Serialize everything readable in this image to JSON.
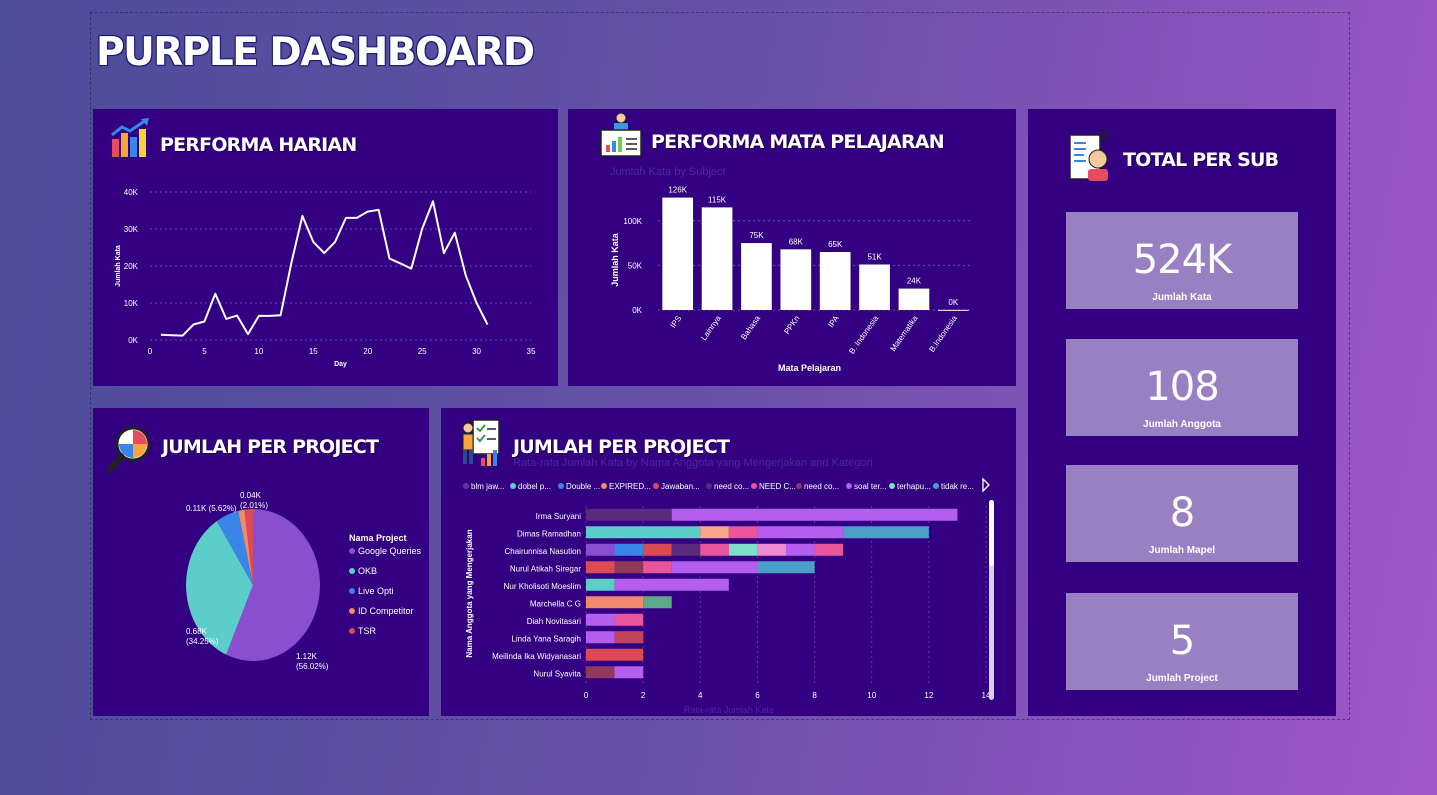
{
  "dashboard": {
    "title": "PURPLE DASHBOARD"
  },
  "colors": {
    "panel": "#330081",
    "card": "#9880c3",
    "line": "#ffffff"
  },
  "daily": {
    "title": "PERFORMA HARIAN",
    "icon": "bar-chart-trend-icon",
    "chart_data": {
      "type": "line",
      "xlabel": "Day",
      "ylabel": "Jumlah Kata",
      "xlim": [
        0,
        35
      ],
      "ylim": [
        0,
        40000
      ],
      "x_ticks": [
        "0",
        "5",
        "10",
        "15",
        "20",
        "25",
        "30",
        "35"
      ],
      "y_ticks": [
        "0K",
        "10K",
        "20K",
        "30K",
        "40K"
      ],
      "x": [
        1,
        2,
        3,
        4,
        5,
        6,
        7,
        8,
        9,
        10,
        11,
        12,
        13,
        14,
        15,
        16,
        17,
        18,
        19,
        20,
        21,
        22,
        23,
        24,
        25,
        26,
        27,
        28,
        29,
        30,
        31
      ],
      "y": [
        1400,
        1300,
        1200,
        4200,
        5000,
        12500,
        5700,
        6600,
        1600,
        6500,
        6500,
        6700,
        21000,
        33500,
        26500,
        23500,
        26500,
        33000,
        33000,
        34700,
        35200,
        22000,
        20700,
        19300,
        30000,
        37500,
        23500,
        29000,
        17500,
        10000,
        4200
      ],
      "grid": true
    }
  },
  "subject": {
    "title": "PERFORMA MATA PELAJARAN",
    "subtitle": "Jumlah Kata by Subject",
    "icon": "presentation-teacher-icon",
    "chart_data": {
      "type": "bar",
      "xlabel": "Mata Pelajaran",
      "ylabel": "Jumlah Kata",
      "categories": [
        "IPS",
        "Lainnya",
        "Bahasa",
        "PPKn",
        "IPA",
        "B. Indonesia",
        "Matematika",
        "B.Indonesia"
      ],
      "values": [
        126000,
        115000,
        75000,
        68000,
        65000,
        51000,
        24000,
        200
      ],
      "data_labels": [
        "126K",
        "115K",
        "75K",
        "68K",
        "65K",
        "51K",
        "24K",
        "0K"
      ],
      "ylim": [
        0,
        130000
      ],
      "y_ticks": [
        "0K",
        "50K",
        "100K"
      ],
      "grid": true
    }
  },
  "total": {
    "title": "TOTAL PER SUB",
    "icon": "profile-document-icon",
    "cards": [
      {
        "value": "524K",
        "label": "Jumlah Kata"
      },
      {
        "value": "108",
        "label": "Jumlah Anggota"
      },
      {
        "value": "8",
        "label": "Jumlah Mapel"
      },
      {
        "value": "5",
        "label": "Jumlah Project"
      }
    ]
  },
  "project_pie": {
    "title": "JUMLAH PER PROJECT",
    "icon": "magnifier-chart-icon",
    "legend_title": "Nama Project",
    "chart_data": {
      "type": "pie",
      "labels": [
        "Google Queries",
        "OKB",
        "Live Opti",
        "ID Competitor",
        "TSR"
      ],
      "values": [
        1120,
        680,
        110,
        30,
        40
      ],
      "colors": [
        "#8a4fd0",
        "#5ccdc8",
        "#3a86e8",
        "#f08a6c",
        "#dc4b55"
      ],
      "data_labels": [
        {
          "line1": "1.12K",
          "line2": "(56.02%)"
        },
        {
          "line1": "0.68K",
          "line2": "(34.25%)"
        },
        {
          "line1": "0.11K (5.62%)",
          "line2": ""
        },
        {
          "line1": "0.04K",
          "line2": "(2.01%)"
        }
      ]
    }
  },
  "project_bar": {
    "title": "JUMLAH PER PROJECT",
    "subtitle": "Rata-rata Jumlah Kata by Nama Anggota yang Mengerjakan and Kategori",
    "icon": "checklist-person-icon",
    "legend": [
      {
        "label": "blm jaw...",
        "color": "#6c2db0"
      },
      {
        "label": "dobel p...",
        "color": "#5ccdc8"
      },
      {
        "label": "Double ...",
        "color": "#3a86e8"
      },
      {
        "label": "EXPIRED...",
        "color": "#f08a6c"
      },
      {
        "label": "Jawaban...",
        "color": "#dc4b55"
      },
      {
        "label": "need co...",
        "color": "#5a2a7c"
      },
      {
        "label": "NEED C...",
        "color": "#e8559a"
      },
      {
        "label": "need co...",
        "color": "#8f3a5a"
      },
      {
        "label": "soal ter...",
        "color": "#b45ef0"
      },
      {
        "label": "terhapu...",
        "color": "#7ee0c8"
      },
      {
        "label": "tidak re...",
        "color": "#4aa0c8"
      }
    ],
    "chart_data": {
      "type": "bar",
      "orientation": "horizontal",
      "stacked": true,
      "ylabel": "Nama Anggota yang Mengerjakan",
      "xlabel": "Rata-rata Jumlah Kata",
      "xlim": [
        0,
        14
      ],
      "x_ticks": [
        "0",
        "2",
        "4",
        "6",
        "8",
        "10",
        "12",
        "14"
      ],
      "categories": [
        "Irma Suryani",
        "Dimas Ramadhan",
        "Chairunnisa Nasution",
        "Nurul Atikah Siregar",
        "Nur Kholisoti Moeslim",
        "Marchella C G",
        "Diah Novitasari",
        "Linda Yana Saragih",
        "Meilinda Ika Widyanasari",
        "Nurul Syavita"
      ],
      "rows": [
        [
          {
            "c": "#5a2a7c",
            "v": 3
          },
          {
            "c": "#b45ef0",
            "v": 10
          }
        ],
        [
          {
            "c": "#5ccdc8",
            "v": 4
          },
          {
            "c": "#f7a88c",
            "v": 1
          },
          {
            "c": "#e8559a",
            "v": 1
          },
          {
            "c": "#b45ef0",
            "v": 3
          },
          {
            "c": "#4aa0c8",
            "v": 3
          }
        ],
        [
          {
            "c": "#8a4fd0",
            "v": 1
          },
          {
            "c": "#3a86e8",
            "v": 1
          },
          {
            "c": "#dc4b55",
            "v": 1
          },
          {
            "c": "#5a2a7c",
            "v": 1
          },
          {
            "c": "#e8559a",
            "v": 1
          },
          {
            "c": "#7ee0c8",
            "v": 1
          },
          {
            "c": "#f08ad0",
            "v": 1
          },
          {
            "c": "#b45ef0",
            "v": 1
          },
          {
            "c": "#e8559a",
            "v": 1
          }
        ],
        [
          {
            "c": "#dc4b55",
            "v": 1
          },
          {
            "c": "#8f3a5a",
            "v": 1
          },
          {
            "c": "#e8559a",
            "v": 1
          },
          {
            "c": "#b45ef0",
            "v": 3
          },
          {
            "c": "#4aa0c8",
            "v": 2
          }
        ],
        [
          {
            "c": "#5ccdc8",
            "v": 1
          },
          {
            "c": "#b45ef0",
            "v": 4
          }
        ],
        [
          {
            "c": "#f08a6c",
            "v": 2
          },
          {
            "c": "#5ea88a",
            "v": 1
          }
        ],
        [
          {
            "c": "#b45ef0",
            "v": 1
          },
          {
            "c": "#e8559a",
            "v": 1
          }
        ],
        [
          {
            "c": "#b45ef0",
            "v": 1
          },
          {
            "c": "#c0455a",
            "v": 1
          }
        ],
        [
          {
            "c": "#dc4b55",
            "v": 2
          }
        ],
        [
          {
            "c": "#8f3a5a",
            "v": 1
          },
          {
            "c": "#b45ef0",
            "v": 1
          }
        ]
      ],
      "grid": true
    }
  }
}
